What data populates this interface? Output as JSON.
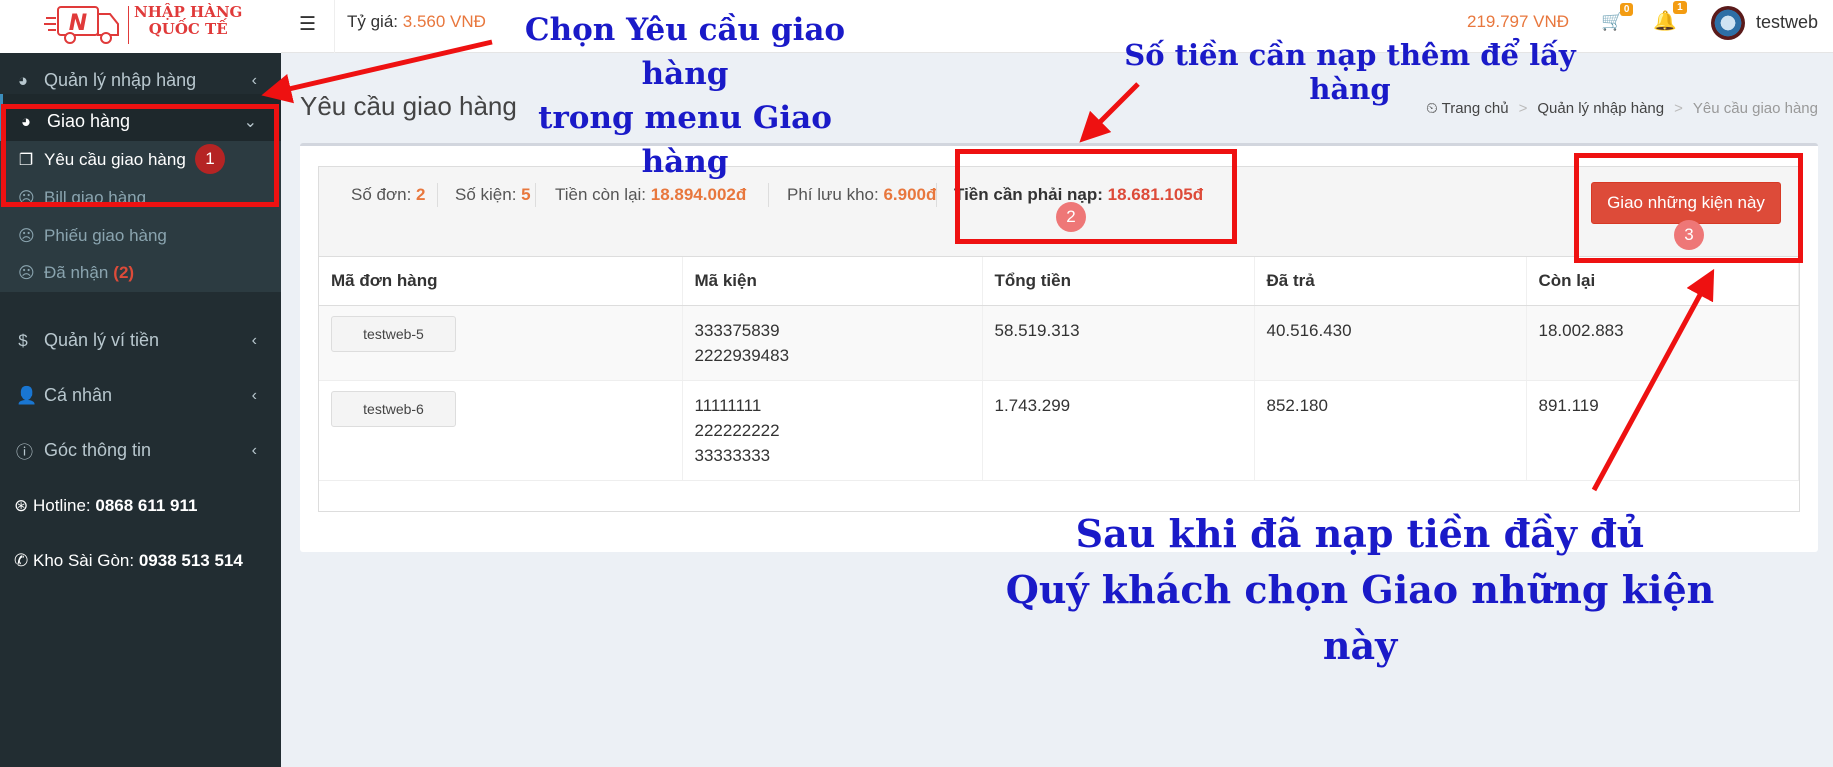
{
  "logo": {
    "line1": "NHẬP HÀNG",
    "line2": "QUỐC TẾ",
    "letter": "N"
  },
  "header": {
    "rate_label": "Tỷ giá:",
    "rate_value": "3.560 VNĐ",
    "balance": "219.797 VNĐ",
    "cart_count": "0",
    "notif_count": "1",
    "username": "testweb"
  },
  "sidebar": {
    "items": [
      {
        "label": "Quản lý nhập hàng"
      },
      {
        "label": "Giao hàng"
      },
      {
        "label": "Quản lý ví tiền"
      },
      {
        "label": "Cá nhân"
      },
      {
        "label": "Góc thông tin"
      }
    ],
    "sub_items": [
      {
        "label": "Yêu cầu giao hàng"
      },
      {
        "label": "Bill giao hàng"
      },
      {
        "label": "Phiếu giao hàng"
      },
      {
        "label": "Đã nhận",
        "count": "(2)"
      }
    ],
    "hotline_label": "Hotline:",
    "hotline_value": "0868 611 911",
    "warehouse_label": "Kho Sài Gòn:",
    "warehouse_value": "0938 513 514"
  },
  "page": {
    "title": "Yêu cầu giao hàng",
    "breadcrumb": [
      "Trang chủ",
      "Quản lý nhập hàng",
      "Yêu cầu giao hàng"
    ]
  },
  "summary": {
    "orders_label": "Số đơn:",
    "orders_value": "2",
    "packages_label": "Số kiện:",
    "packages_value": "5",
    "remaining_label": "Tiền còn lại:",
    "remaining_value": "18.894.002đ",
    "storage_label": "Phí lưu kho:",
    "storage_value": "6.900đ",
    "need_label": "Tiền cần phải nạp:",
    "need_value": "18.681.105đ",
    "deliver_button": "Giao những kiện này"
  },
  "table": {
    "headers": [
      "Mã đơn hàng",
      "Mã kiện",
      "Tổng tiền",
      "Đã trả",
      "Còn lại"
    ],
    "rows": [
      {
        "order": "testweb-5",
        "packages": [
          "333375839",
          "2222939483"
        ],
        "total": "58.519.313",
        "paid": "40.516.430",
        "remaining": "18.002.883"
      },
      {
        "order": "testweb-6",
        "packages": [
          "11111111",
          "222222222",
          "33333333"
        ],
        "total": "1.743.299",
        "paid": "852.180",
        "remaining": "891.119"
      }
    ]
  },
  "annotations": {
    "top_line1": "Chọn Yêu cầu giao hàng",
    "top_line2": "trong menu Giao hàng",
    "amount_note": "Số tiền cần nạp thêm để lấy hàng",
    "bottom_line1": "Sau khi đã nạp tiền đầy đủ",
    "bottom_line2": "Quý khách chọn Giao những kiện này",
    "step1": "1",
    "step2": "2",
    "step3": "3",
    "color": "#1a1ac8",
    "box_color": "#ee1111"
  }
}
